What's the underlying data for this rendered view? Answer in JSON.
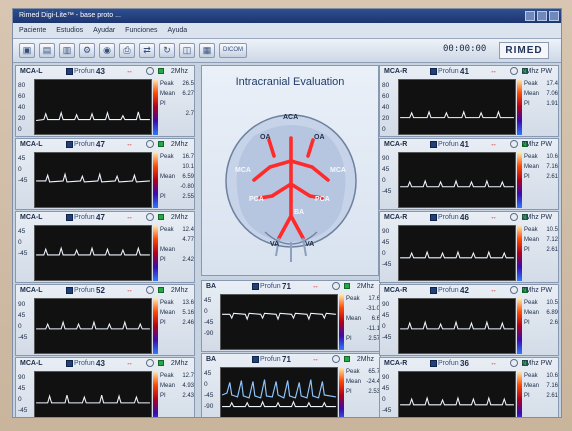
{
  "window": {
    "title": "Rimed Digi-Lite™ - base proto ...",
    "clock": "00:00:00",
    "brand": "RIMED"
  },
  "menu": [
    "Paciente",
    "Estudios",
    "Ayudar",
    "Funciones",
    "Ayuda"
  ],
  "toolbar": {
    "dicom": "DICOM"
  },
  "center": {
    "title": "Intracranial Evaluation",
    "labels": [
      "ACA",
      "OA",
      "OA",
      "MCA",
      "MCA",
      "PCA",
      "PCA",
      "BA",
      "VA",
      "VA"
    ]
  },
  "left_panels": [
    {
      "ch": "MCA-L",
      "prof": "Profun",
      "depth": "43",
      "freq": "2Mhz",
      "scale": [
        "80",
        "60",
        "40",
        "20",
        "0"
      ],
      "vals": [
        [
          "Peak",
          "26.5"
        ],
        [
          "Mean",
          "6.27"
        ],
        [
          "PI",
          ""
        ],
        [
          "",
          "2.7"
        ]
      ]
    },
    {
      "ch": "MCA-L",
      "prof": "Profun",
      "depth": "47",
      "freq": "2Mhz",
      "scale": [
        "45",
        "",
        "0",
        "-45",
        ""
      ],
      "vals": [
        [
          "Peak",
          "16.7"
        ],
        [
          "",
          "10.1"
        ],
        [
          "Mean",
          "6.59"
        ],
        [
          "",
          "-0.80"
        ],
        [
          "PI",
          "2.55"
        ],
        [
          "",
          "0.21"
        ]
      ]
    },
    {
      "ch": "MCA-L",
      "prof": "Profun",
      "depth": "47",
      "freq": "2Mhz",
      "scale": [
        "45",
        "",
        "0",
        "-45",
        ""
      ],
      "vals": [
        [
          "Peak",
          "12.4"
        ],
        [
          "",
          "4.77"
        ],
        [
          "Mean",
          ""
        ],
        [
          "PI",
          "2.42"
        ]
      ]
    },
    {
      "ch": "MCA-L",
      "prof": "Profun",
      "depth": "52",
      "freq": "2Mhz",
      "scale": [
        "90",
        "45",
        "0",
        "-45",
        ""
      ],
      "vals": [
        [
          "Peak",
          "13.6"
        ],
        [
          "Mean",
          "5.16"
        ],
        [
          "PI",
          "2.46"
        ]
      ]
    },
    {
      "ch": "MCA-L",
      "prof": "Profun",
      "depth": "43",
      "freq": "2Mhz",
      "scale": [
        "90",
        "45",
        "0",
        "-45",
        ""
      ],
      "vals": [
        [
          "Peak",
          "12.7"
        ],
        [
          "Mean",
          "4.93"
        ],
        [
          "PI",
          "2.43"
        ]
      ]
    }
  ],
  "right_panels": [
    {
      "ch": "MCA-R",
      "prof": "Profun",
      "depth": "41",
      "freq": "2Mhz PW",
      "scale": [
        "80",
        "60",
        "40",
        "20",
        "0"
      ],
      "vals": [
        [
          "Peak",
          "17.4"
        ],
        [
          "Mean",
          "7.06"
        ],
        [
          "PI",
          "1.91"
        ]
      ]
    },
    {
      "ch": "MCA-R",
      "prof": "Profun",
      "depth": "41",
      "freq": "2Mhz PW",
      "scale": [
        "90",
        "45",
        "0",
        "-45",
        ""
      ],
      "vals": [
        [
          "Peak",
          "10.6"
        ],
        [
          "Mean",
          "7.16"
        ],
        [
          "PI",
          "2.61"
        ]
      ]
    },
    {
      "ch": "MCA-R",
      "prof": "Profun",
      "depth": "46",
      "freq": "2Mhz PW",
      "scale": [
        "90",
        "45",
        "0",
        "-45",
        ""
      ],
      "vals": [
        [
          "Peak",
          "10.5"
        ],
        [
          "Mean",
          "7.12"
        ],
        [
          "PI",
          "2.61"
        ]
      ]
    },
    {
      "ch": "MCA-R",
      "prof": "Profun",
      "depth": "42",
      "freq": "2Mhz PW",
      "scale": [
        "90",
        "45",
        "0",
        "-45",
        ""
      ],
      "vals": [
        [
          "Peak",
          "10.5"
        ],
        [
          "Mean",
          "6.89"
        ],
        [
          "PI",
          "2.6"
        ]
      ]
    },
    {
      "ch": "MCA-R",
      "prof": "Profun",
      "depth": "36",
      "freq": "2Mhz PW",
      "scale": [
        "90",
        "45",
        "0",
        "-45",
        ""
      ],
      "vals": [
        [
          "Peak",
          "10.6"
        ],
        [
          "Mean",
          "7.16"
        ],
        [
          "PI",
          "2.61"
        ]
      ]
    }
  ],
  "bottom_center": [
    {
      "ch": "BA",
      "prof": "Profun",
      "depth": "71",
      "freq": "2Mhz",
      "scale": [
        "45",
        "0",
        "-45",
        "-90",
        ""
      ],
      "vals": [
        [
          "Peak",
          "17.6"
        ],
        [
          "",
          "-31.0"
        ],
        [
          "Mean",
          "6.6"
        ],
        [
          "",
          "-11.1"
        ],
        [
          "PI",
          "2.57"
        ],
        [
          "",
          "2.59"
        ]
      ]
    },
    {
      "ch": "BA",
      "prof": "Profun",
      "depth": "71",
      "freq": "2Mhz",
      "scale": [
        "45",
        "0",
        "-45",
        "-90",
        ""
      ],
      "vals": [
        [
          "Peak",
          "65.7"
        ],
        [
          "Mean",
          "-24.4"
        ],
        [
          "PI",
          "2.53"
        ]
      ]
    }
  ]
}
